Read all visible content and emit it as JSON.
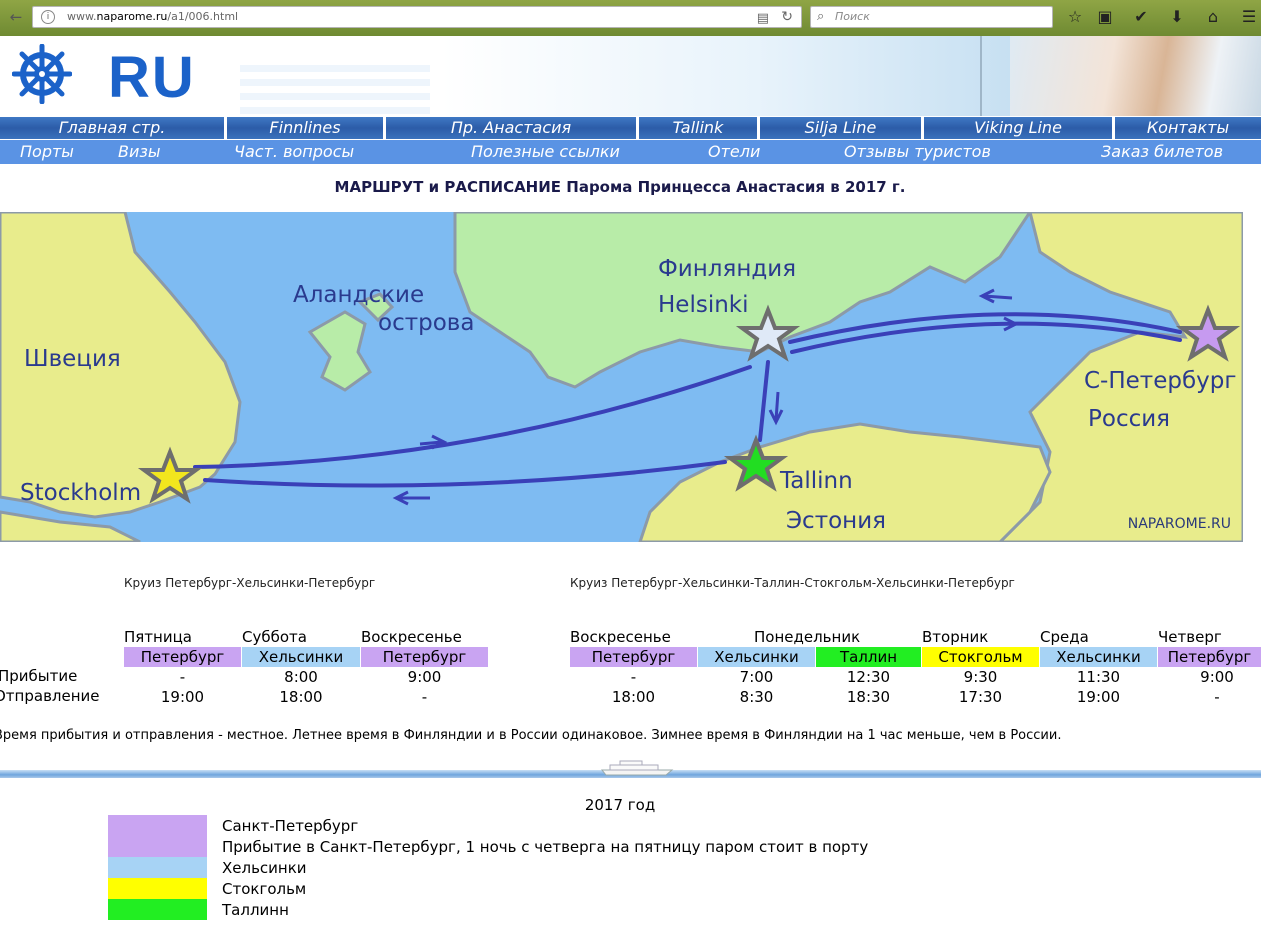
{
  "browser": {
    "url_prefix": "www.",
    "url_domain": "naparome.ru",
    "url_path": "/a1/006.html",
    "search_placeholder": "Поиск"
  },
  "site": {
    "logo": "RU"
  },
  "nav_primary": [
    {
      "label": "Главная стр."
    },
    {
      "label": "Finnlines"
    },
    {
      "label": "Пр. Анастасия"
    },
    {
      "label": "Tallink"
    },
    {
      "label": "Silja Line"
    },
    {
      "label": "Viking Line"
    },
    {
      "label": "Контакты"
    }
  ],
  "nav_secondary": [
    {
      "label": "Порты"
    },
    {
      "label": "Визы"
    },
    {
      "label": "Част. вопросы"
    },
    {
      "label": "Полезные ссылки"
    },
    {
      "label": "Отели"
    },
    {
      "label": "Отзывы туристов"
    },
    {
      "label": "Заказ билетов"
    }
  ],
  "page_title": "МАРШРУТ и РАСПИСАНИЕ Парома Принцесса Анастасия в 2017 г.",
  "map": {
    "labels": {
      "sweden": "Швеция",
      "aland1": "Аландские",
      "aland2": "острова",
      "finland": "Финляндия",
      "helsinki": "Helsinki",
      "spb": "С-Петербург",
      "russia": "Россия",
      "stockholm": "Stockholm",
      "tallinn": "Tallinn",
      "estonia": "Эстония"
    },
    "credit": "NAPAROME.RU",
    "colors": {
      "sea": "#7ebbf2",
      "land": "#e8ec8c",
      "finland": "#b8eca8",
      "route": "#3a40b8"
    }
  },
  "cruise1": {
    "title": "Круиз Петербург-Хельсинки-Петербург",
    "days": [
      "Пятница",
      "Суббота",
      "Воскресенье"
    ],
    "ports": [
      "Петербург",
      "Хельсинки",
      "Петербург"
    ],
    "arrival": [
      "-",
      "8:00",
      "9:00"
    ],
    "departure": [
      "19:00",
      "18:00",
      "-"
    ]
  },
  "cruise2": {
    "title": "Круиз Петербург-Хельсинки-Таллин-Стокгольм-Хельсинки-Петербург",
    "days": [
      "Воскресенье",
      "Понедельник",
      "Вторник",
      "Среда",
      "Четверг"
    ],
    "ports": [
      "Петербург",
      "Хельсинки",
      "Таллин",
      "Стокгольм",
      "Хельсинки",
      "Петербург"
    ],
    "arrival": [
      "-",
      "7:00",
      "12:30",
      "9:30",
      "11:30",
      "9:00"
    ],
    "departure": [
      "18:00",
      "8:30",
      "18:30",
      "17:30",
      "19:00",
      "-"
    ]
  },
  "row_labels": {
    "arrival": "Прибытие",
    "departure": "Отправление"
  },
  "note": "Время прибытия и отправления - местное.  Летнее время в Финляндии и в России одинаковое. Зимнее время в Финляндии на 1 час меньше, чем в России.",
  "year": "2017 год",
  "legend": [
    {
      "text": "Санкт-Петербург",
      "color": "#c9a4f2"
    },
    {
      "text": "Прибытие в Санкт-Петербург, 1 ночь с четверга на пятницу паром стоит в порту",
      "color": "#c9a4f2"
    },
    {
      "text": "Хельсинки",
      "color": "#a7d3f5"
    },
    {
      "text": "Стокгольм",
      "color": "#ffff00"
    },
    {
      "text": "Таллинн",
      "color": "#22ee22"
    }
  ],
  "port_colors": {
    "spb": "#c9a4f2",
    "helsinki": "#a7d3f5",
    "tallinn": "#22ee22",
    "stockholm": "#ffff00"
  }
}
